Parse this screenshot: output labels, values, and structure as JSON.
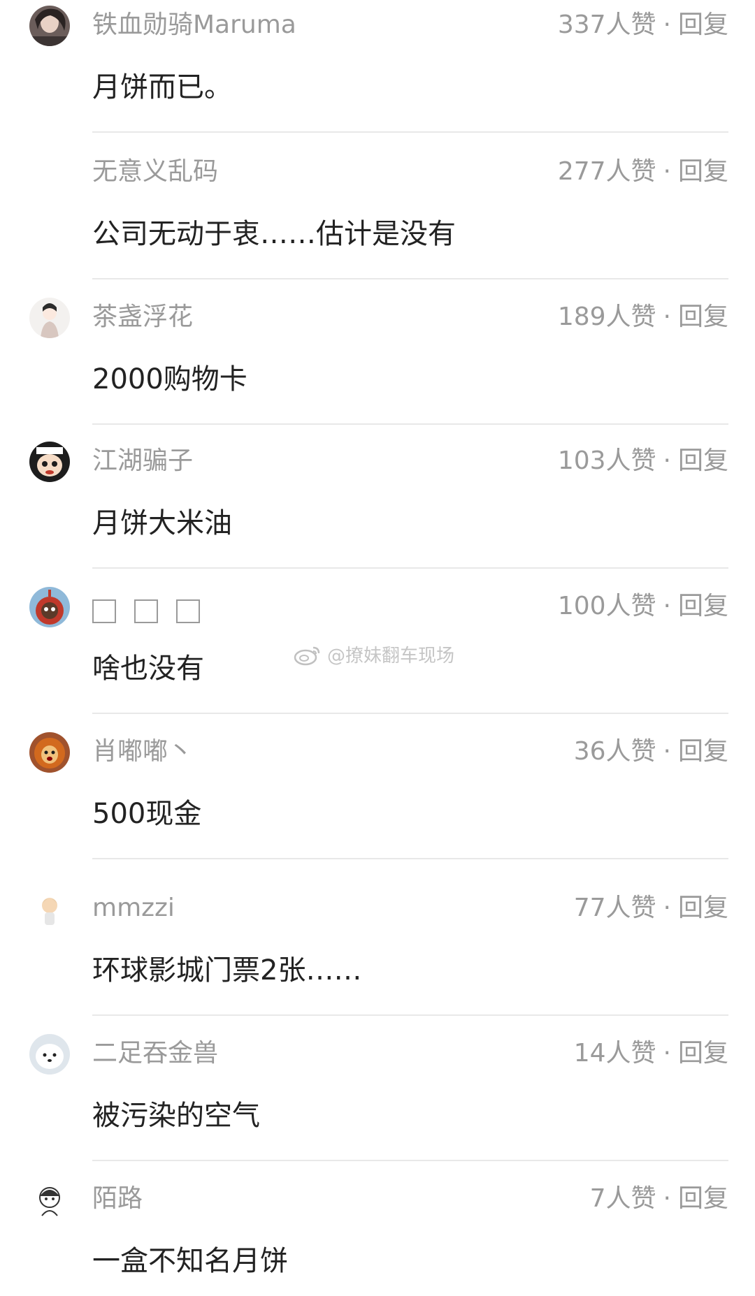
{
  "comments": [
    {
      "username": "铁血勋骑Maruma",
      "likes": "337人赞",
      "reply": "回复",
      "text": "月饼而已。",
      "avatar": "avatar-dark-hair"
    },
    {
      "username": "无意义乱码",
      "likes": "277人赞",
      "reply": "回复",
      "text": "公司无动于衷……估计是没有",
      "avatar": "none"
    },
    {
      "username": "茶盏浮花",
      "likes": "189人赞",
      "reply": "回复",
      "text": "2000购物卡",
      "avatar": "avatar-girl-drawing"
    },
    {
      "username": "江湖骗子",
      "likes": "103人赞",
      "reply": "回复",
      "text": "月饼大米油",
      "avatar": "avatar-cartoon-face"
    },
    {
      "username": "",
      "likes": "100人赞",
      "reply": "回复",
      "text": "啥也没有",
      "avatar": "avatar-red-toy"
    },
    {
      "username": "肖嘟嘟丶",
      "likes": "36人赞",
      "reply": "回复",
      "text": "500现金",
      "avatar": "avatar-lion"
    },
    {
      "username": "mmzzi",
      "likes": "77人赞",
      "reply": "回复",
      "text": "环球影城门票2张……",
      "avatar": "avatar-small-person"
    },
    {
      "username": "二足吞金兽",
      "likes": "14人赞",
      "reply": "回复",
      "text": "被污染的空气",
      "avatar": "avatar-white-dog"
    },
    {
      "username": "陌路",
      "likes": "7人赞",
      "reply": "回复",
      "text": "一盒不知名月饼",
      "avatar": "avatar-sketch-girl"
    }
  ],
  "separator": "·",
  "watermark": "@撩妹翻车现场"
}
